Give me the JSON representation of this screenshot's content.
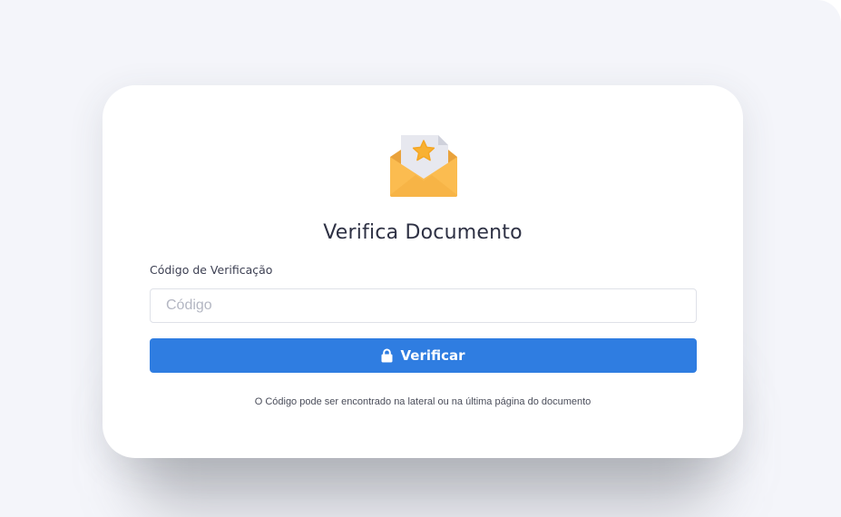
{
  "card": {
    "icon": "envelope-star-icon",
    "title": "Verifica Documento",
    "field_label": "Código de Verificação",
    "input": {
      "value": "",
      "placeholder": "Código"
    },
    "button": {
      "icon": "lock-icon",
      "label": "Verificar"
    },
    "hint": "O Código pode ser encontrado na lateral ou na última página do documento"
  },
  "colors": {
    "page_background": "#f4f5fa",
    "card_background": "#ffffff",
    "button": "#2f7de1",
    "envelope": "#fbbc50",
    "star": "#f8b133"
  }
}
